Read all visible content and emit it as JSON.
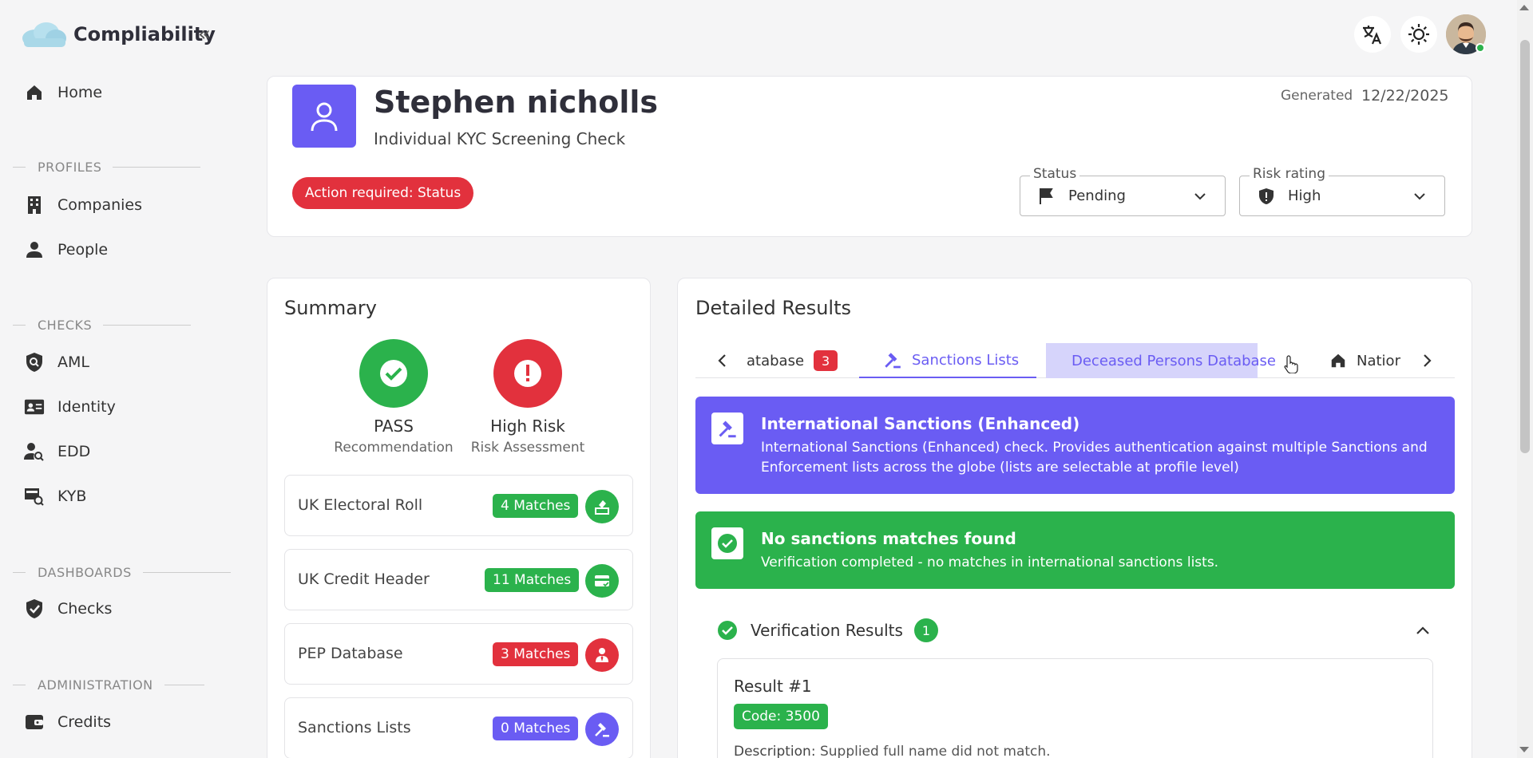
{
  "app": {
    "title": "Compliability"
  },
  "sidebar": {
    "items": [
      {
        "label": "Home",
        "icon": "home-icon"
      },
      {
        "label": "Companies",
        "icon": "building-icon"
      },
      {
        "label": "People",
        "icon": "person-icon"
      },
      {
        "label": "AML",
        "icon": "shield-search-icon"
      },
      {
        "label": "Identity",
        "icon": "id-card-icon"
      },
      {
        "label": "EDD",
        "icon": "person-search-icon"
      },
      {
        "label": "KYB",
        "icon": "business-search-icon"
      },
      {
        "label": "Checks",
        "icon": "shield-check-icon"
      },
      {
        "label": "Credits",
        "icon": "wallet-icon"
      }
    ],
    "sections": [
      "PROFILES",
      "CHECKS",
      "DASHBOARDS",
      "ADMINISTRATION"
    ]
  },
  "profile": {
    "name": "Stephen nicholls",
    "subtitle": "Individual KYC Screening Check",
    "action_badge": "Action required: Status",
    "generated_label": "Generated",
    "generated_date": "12/22/2025",
    "status": {
      "label": "Status",
      "value": "Pending"
    },
    "risk": {
      "label": "Risk rating",
      "value": "High"
    }
  },
  "summary": {
    "title": "Summary",
    "recommendation": {
      "value": "PASS",
      "label": "Recommendation"
    },
    "risk_assessment": {
      "value": "High Risk",
      "label": "Risk Assessment"
    },
    "rows": [
      {
        "label": "UK Electoral Roll",
        "badge": "4 Matches",
        "color": "#2bb24c"
      },
      {
        "label": "UK Credit Header",
        "badge": "11 Matches",
        "color": "#2bb24c"
      },
      {
        "label": "PEP Database",
        "badge": "3 Matches",
        "color": "#e2313d"
      },
      {
        "label": "Sanctions Lists",
        "badge": "0 Matches",
        "color": "#6a5cf3"
      }
    ]
  },
  "details": {
    "title": "Detailed Results",
    "tabs": [
      {
        "label": "atabase",
        "badge": "3"
      },
      {
        "label": "Sanctions Lists"
      },
      {
        "label": "Deceased Persons Database"
      },
      {
        "label": "Natior"
      }
    ],
    "info_banner": {
      "title": "International Sanctions (Enhanced)",
      "text": "International Sanctions (Enhanced) check. Provides authentication against multiple Sanctions and Enforcement lists across the globe (lists are selectable at profile level)"
    },
    "success_banner": {
      "title": "No sanctions matches found",
      "text": "Verification completed - no matches in international sanctions lists."
    },
    "verification": {
      "title": "Verification Results",
      "count": "1",
      "result_title": "Result #1",
      "code": "Code: 3500",
      "desc_label": "Description:",
      "desc_text": "Supplied full name did not match."
    }
  },
  "colors": {
    "primary": "#6a5cf3",
    "success": "#2bb24c",
    "danger": "#e2313d"
  }
}
